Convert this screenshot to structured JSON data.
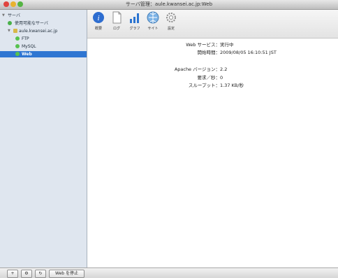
{
  "window": {
    "title": "サーバ管理：aule.kwansei.ac.jp:Web"
  },
  "sidebar": {
    "section_label": "サーバ",
    "items": [
      {
        "label": "使用可能なサーバ"
      },
      {
        "label": "aule.kwansei.ac.jp"
      },
      {
        "label": "FTP"
      },
      {
        "label": "MySQL"
      },
      {
        "label": "Web"
      }
    ]
  },
  "toolbar": {
    "tools": [
      {
        "label": "概要",
        "icon": "info-icon"
      },
      {
        "label": "ログ",
        "icon": "document-icon"
      },
      {
        "label": "グラフ",
        "icon": "bar-chart-icon"
      },
      {
        "label": "サイト",
        "icon": "globe-icon"
      },
      {
        "label": "設定",
        "icon": "gear-icon"
      }
    ]
  },
  "status": {
    "web_service_label": "Web サービス：",
    "web_service_value": "実行中",
    "start_time_label": "開始時間：",
    "start_time_value": "2009/08/05 16:10:51 JST",
    "apache_version_label": "Apache バージョン：",
    "apache_version_value": "2.2",
    "requests_label": "要求／秒：",
    "requests_value": "0",
    "throughput_label": "スループット：",
    "throughput_value": "1.37 KB/秒"
  },
  "bottom": {
    "add_label": "+",
    "action_label": "⚙",
    "refresh_label": "↻",
    "stop_label": "Web を停止"
  }
}
